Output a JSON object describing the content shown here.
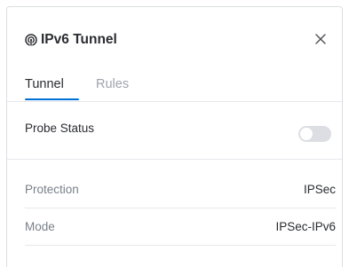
{
  "header": {
    "title": "IPv6 Tunnel",
    "title_icon": "radio-signal-icon",
    "close_icon": "close-icon"
  },
  "tabs": [
    {
      "label": "Tunnel",
      "active": true
    },
    {
      "label": "Rules",
      "active": false
    }
  ],
  "probe_status": {
    "label": "Probe Status",
    "enabled": false
  },
  "details": [
    {
      "label": "Protection",
      "value": "IPSec"
    },
    {
      "label": "Mode",
      "value": "IPSec-IPv6"
    }
  ],
  "colors": {
    "accent": "#0070d9",
    "text_primary": "#2a2c31",
    "text_muted": "#7a808a",
    "toggle_off": "#dcdee3"
  }
}
